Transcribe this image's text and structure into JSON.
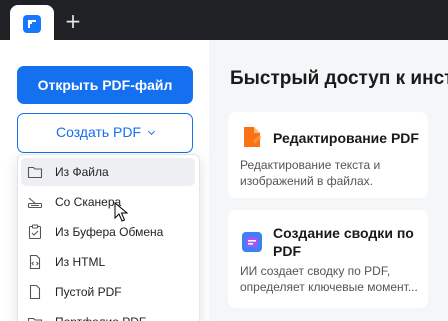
{
  "tabbar": {
    "tab_logo": "pdf-app-logo-icon",
    "new_tab": "+"
  },
  "sidebar": {
    "open_button": "Открыть PDF-файл",
    "create_button": "Создать PDF",
    "create_menu": [
      {
        "label": "Из Файла",
        "icon": "folder-icon"
      },
      {
        "label": "Со Сканера",
        "icon": "scanner-icon"
      },
      {
        "label": "Из Буфера Обмена",
        "icon": "clipboard-icon"
      },
      {
        "label": "Из HTML",
        "icon": "html-file-icon"
      },
      {
        "label": "Пустой PDF",
        "icon": "blank-page-icon"
      },
      {
        "label": "Портфолио PDF",
        "icon": "portfolio-icon"
      }
    ]
  },
  "main": {
    "heading": "Быстрый доступ к инст",
    "cards": [
      {
        "title": "Редактирование PDF",
        "desc_line1": "Редактирование текста и",
        "desc_line2": "изображений в файлах.",
        "icon": "edit-pdf-icon"
      },
      {
        "title_line1": "Создание сводки по",
        "title_line2": "PDF",
        "desc_line1": "ИИ создает сводку по PDF,",
        "desc_line2": "определяет ключевые момент...",
        "icon": "ai-summary-icon"
      }
    ]
  },
  "colors": {
    "accent": "#1570ef",
    "edit_icon": "#f97316",
    "ai_icon": "#3b82f6"
  }
}
